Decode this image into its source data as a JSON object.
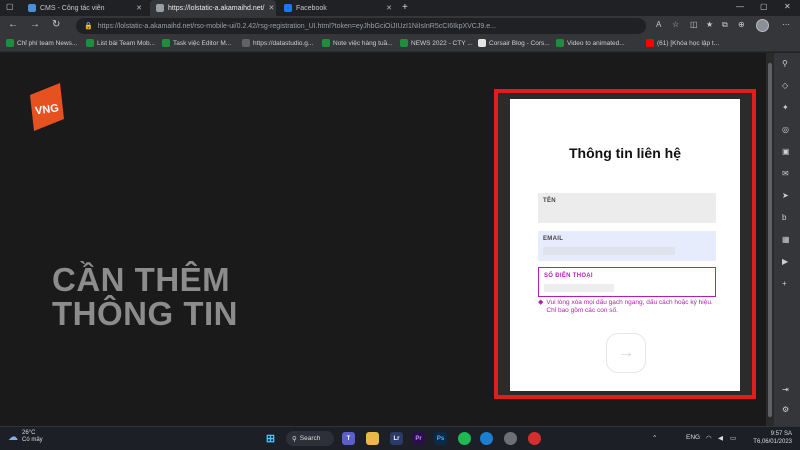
{
  "browser": {
    "tabs": [
      {
        "label": "CMS - Công tác viên",
        "favicon_color": "#4a90d9",
        "active": false
      },
      {
        "label": "https://lolstatic-a.akamaihd.net/",
        "favicon_color": "#9aa0a6",
        "active": true
      },
      {
        "label": "Facebook",
        "favicon_color": "#1877f2",
        "active": false
      }
    ],
    "new_tab_label": "+",
    "url": "https://lolstatic-a.akamaihd.net/rso-mobile-ui/0.2.42/rsg-registration_UI.html?token=eyJhbGciOiJIUzI1NiIsInR5cCI6IkpXVCJ9.e...",
    "bookmarks": [
      {
        "label": "Chỉ phí team News...",
        "color": "#1e8e3e"
      },
      {
        "label": "List bài Team Mob...",
        "color": "#1e8e3e"
      },
      {
        "label": "Task việc Editor M...",
        "color": "#1e8e3e"
      },
      {
        "label": "https://datastudio.g...",
        "color": "#5f6368"
      },
      {
        "label": "Note việc hàng tuầ...",
        "color": "#1e8e3e"
      },
      {
        "label": "NEWS 2022 - CTY ...",
        "color": "#1e8e3e"
      },
      {
        "label": "Corsair Blog - Cors...",
        "color": "#e5e5e5"
      },
      {
        "label": "Video to animated...",
        "color": "#1e8e3e"
      },
      {
        "label": "(61) [Khóa học lập t...",
        "color": "#ff0000"
      }
    ]
  },
  "page": {
    "logo_text": "VNG",
    "headline": [
      "CẦN THÊM",
      "THÔNG TIN"
    ],
    "form": {
      "title": "Thông tin liên hệ",
      "name_label": "TÊN",
      "email_label": "EMAIL",
      "phone_label": "SỐ ĐIỆN THOẠI",
      "error_message": "Vui lòng xóa mọi dấu gạch ngang, dấu cách hoặc ký hiệu. Chỉ bao gồm các con số.",
      "submit_icon": "arrow-right-icon"
    }
  },
  "taskbar": {
    "temperature": "26°C",
    "weather": "Có mây",
    "search_label": "Search",
    "language": "ENG",
    "time": "9:57 SA",
    "date": "T6,06/01/2023"
  },
  "colors": {
    "frame": "#e01e1e",
    "error": "#b21fb5",
    "brand": "#e5521f"
  }
}
